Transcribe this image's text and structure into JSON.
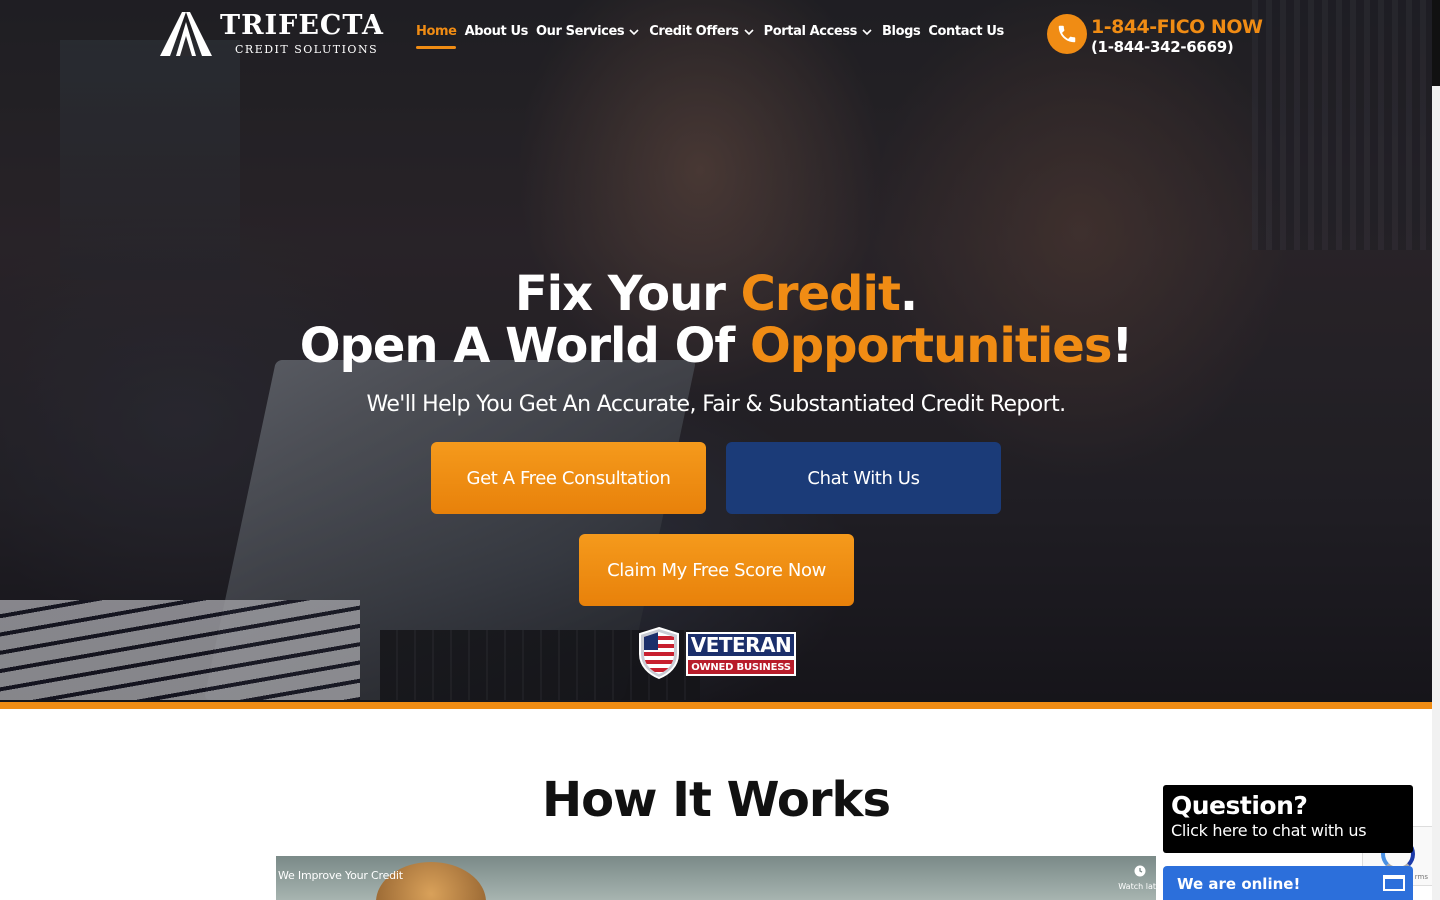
{
  "brand": {
    "name": "TRIFECTA",
    "tagline": "CREDIT SOLUTIONS"
  },
  "nav": {
    "items": [
      {
        "label": "Home",
        "active": true,
        "dropdown": false
      },
      {
        "label": "About Us",
        "active": false,
        "dropdown": false
      },
      {
        "label": "Our Services",
        "active": false,
        "dropdown": true
      },
      {
        "label": "Credit Offers",
        "active": false,
        "dropdown": true
      },
      {
        "label": "Portal Access",
        "active": false,
        "dropdown": true
      },
      {
        "label": "Blogs",
        "active": false,
        "dropdown": false
      },
      {
        "label": "Contact Us",
        "active": false,
        "dropdown": false
      }
    ]
  },
  "contact": {
    "phone_vanity": "1-844-FICO NOW",
    "phone_number": "(1-844-342-6669)",
    "icon": "phone-icon"
  },
  "hero": {
    "headline_line1_prefix": "Fix Your ",
    "headline_line1_accent": "Credit",
    "headline_line1_suffix": ".",
    "headline_line2_prefix": "Open A World Of ",
    "headline_line2_accent": "Opportunities",
    "headline_line2_suffix": "!",
    "subheadline": "We'll Help You Get An Accurate, Fair & Substantiated Credit Report.",
    "buttons": {
      "consultation": "Get A Free Consultation",
      "chat": "Chat With Us",
      "score": "Claim My Free Score Now"
    },
    "badge": {
      "line1": "VETERAN",
      "line2": "OWNED BUSINESS"
    }
  },
  "how_it_works": {
    "title": "How It Works",
    "video_title": "We Improve Your Credit",
    "video_watch_label": "Watch lat"
  },
  "chat_widget": {
    "question": "Question?",
    "prompt": "Click here to chat with us",
    "status": "We are online!"
  },
  "recaptcha": {
    "footer": "rms"
  },
  "colors": {
    "accent": "#f08c14",
    "primary_blue": "#1b3b78",
    "chat_blue": "#2c6fdb"
  }
}
